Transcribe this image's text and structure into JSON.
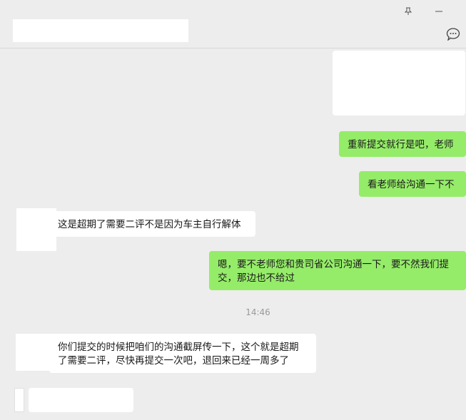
{
  "header": {
    "pin_icon": "pin-icon",
    "minimize_icon": "minimize-icon",
    "more_icon": "chat-bubble-icon"
  },
  "messages": [
    {
      "side": "me",
      "type": "image"
    },
    {
      "side": "me",
      "type": "text",
      "text": "重新提交就行是吧，老师"
    },
    {
      "side": "me",
      "type": "text",
      "text": "看老师给沟通一下不"
    },
    {
      "side": "them",
      "type": "text",
      "text": "这是超期了需要二评不是因为车主自行解体"
    },
    {
      "side": "me",
      "type": "text",
      "text": "嗯，要不老师您和贵司省公司沟通一下，要不然我们提交，那边也不给过"
    },
    {
      "side": "system",
      "type": "time",
      "text": "14:46"
    },
    {
      "side": "them",
      "type": "text",
      "text": "你们提交的时候把咱们的沟通截屏传一下，这个就是超期了需要二评，尽快再提交一次吧，退回来已经一周多了"
    },
    {
      "side": "them",
      "type": "image"
    }
  ],
  "colors": {
    "background": "#ededed",
    "me_bubble": "#95ec69",
    "them_bubble": "#ffffff"
  }
}
